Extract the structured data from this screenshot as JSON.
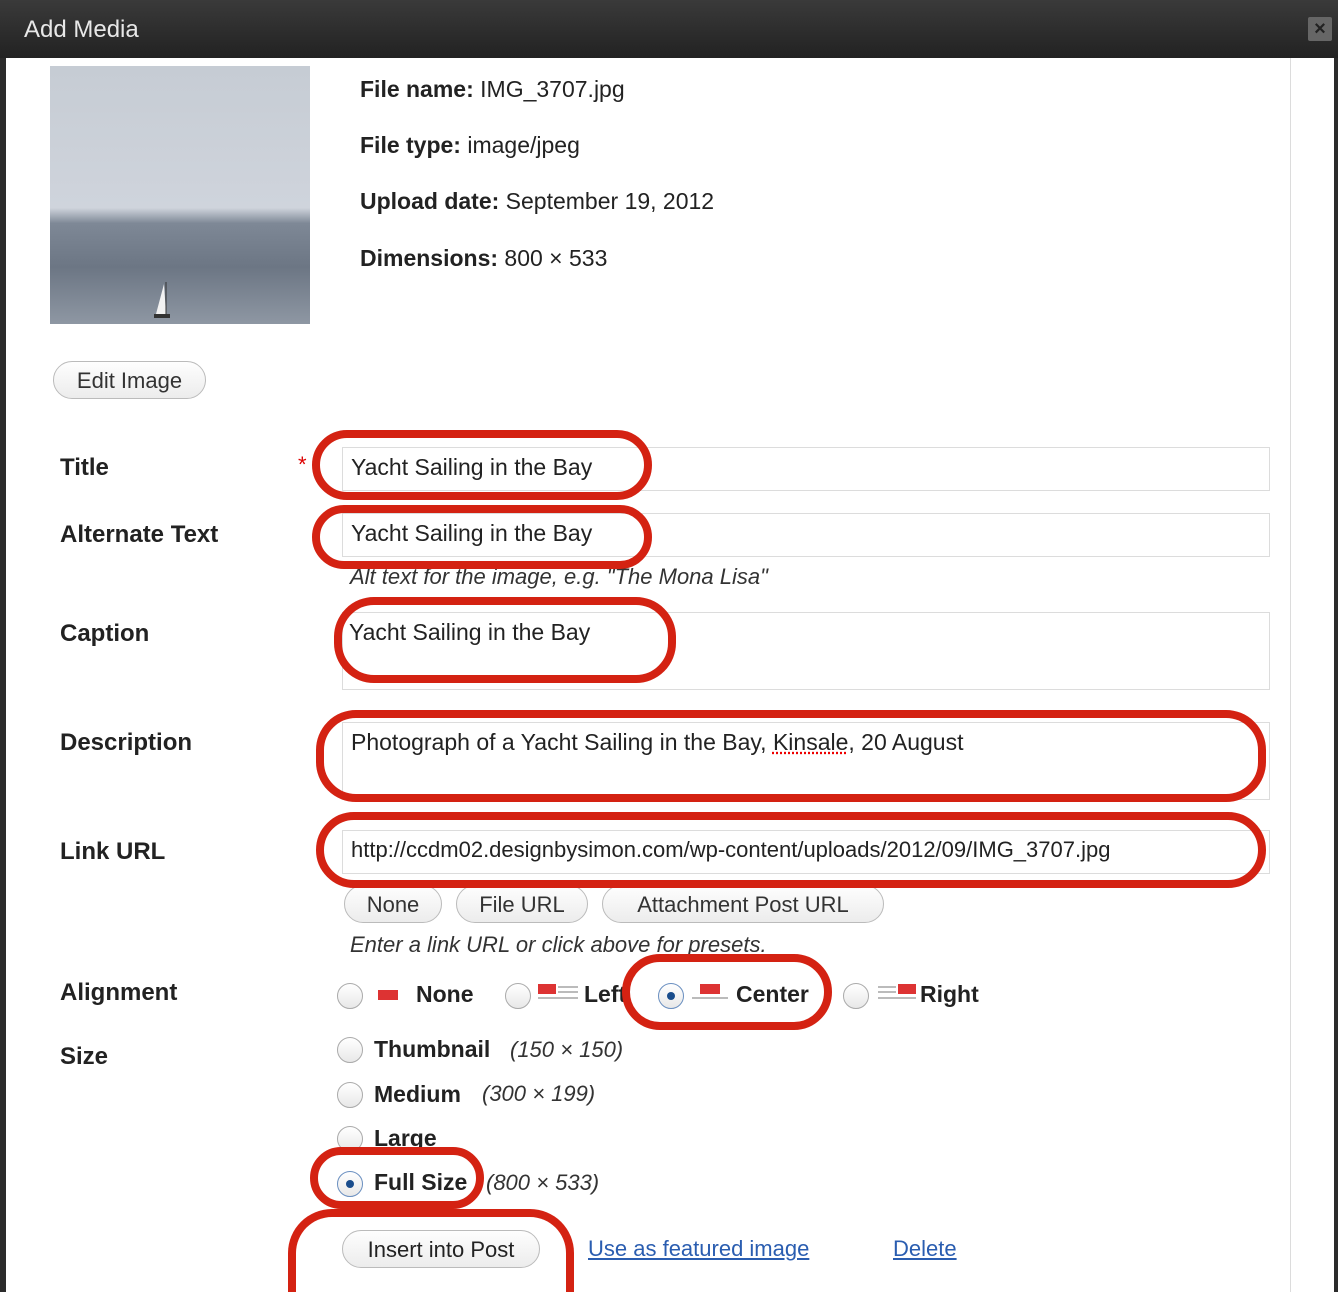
{
  "dialog": {
    "title": "Add Media"
  },
  "file": {
    "name_label": "File name:",
    "name_value": "IMG_3707.jpg",
    "type_label": "File type:",
    "type_value": "image/jpeg",
    "date_label": "Upload date:",
    "date_value": "September 19, 2012",
    "dim_label": "Dimensions:",
    "dim_value": "800 × 533"
  },
  "edit_image_label": "Edit Image",
  "fields": {
    "title_label": "Title",
    "title_value": "Yacht Sailing in the Bay",
    "alt_label": "Alternate Text",
    "alt_value": "Yacht Sailing in the Bay",
    "alt_hint": "Alt text for the image, e.g. \"The Mona Lisa\"",
    "caption_label": "Caption",
    "caption_value": "Yacht Sailing in the Bay",
    "description_label": "Description",
    "description_prefix": "Photograph of a Yacht Sailing in the Bay, ",
    "description_spelled": "Kinsale",
    "description_suffix": ", 20 August",
    "link_label": "Link URL",
    "link_value": "http://ccdm02.designbysimon.com/wp-content/uploads/2012/09/IMG_3707.jpg",
    "link_hint": "Enter a link URL or click above for presets."
  },
  "link_buttons": {
    "none": "None",
    "file_url": "File URL",
    "attachment": "Attachment Post URL"
  },
  "alignment": {
    "label": "Alignment",
    "none": "None",
    "left": "Left",
    "center": "Center",
    "right": "Right",
    "selected": "Center"
  },
  "size": {
    "label": "Size",
    "thumbnail": "Thumbnail",
    "thumbnail_dim": "(150 × 150)",
    "medium": "Medium",
    "medium_dim": "(300 × 199)",
    "large": "Large",
    "full": "Full Size",
    "full_dim": "(800 × 533)",
    "selected": "Full Size"
  },
  "actions": {
    "insert": "Insert into Post",
    "featured": "Use as featured image",
    "delete": "Delete"
  },
  "colors": {
    "annotation": "#d42212",
    "link": "#2a5db0"
  }
}
